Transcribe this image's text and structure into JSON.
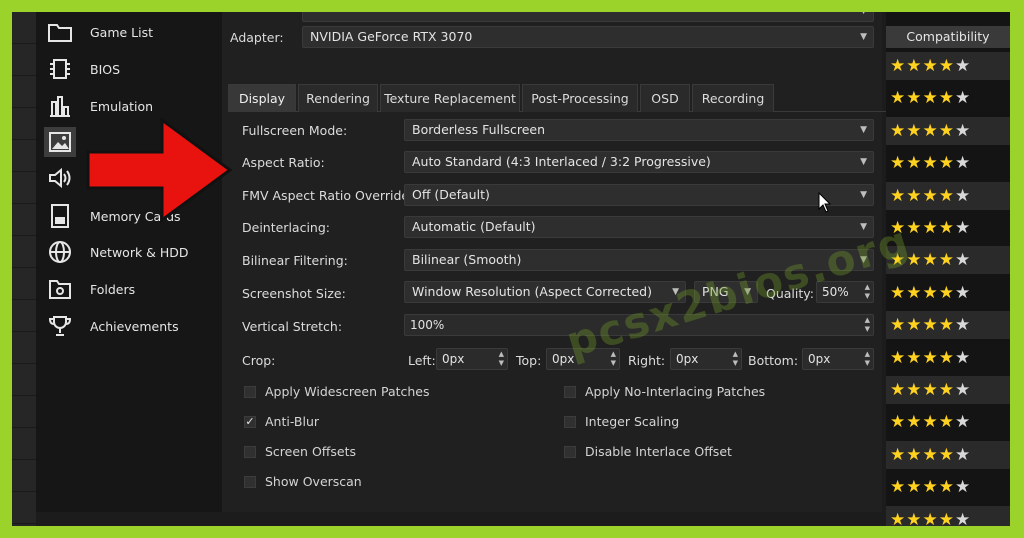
{
  "sidebar": {
    "items": [
      {
        "label": "Game List",
        "icon": "folder-icon"
      },
      {
        "label": "BIOS",
        "icon": "chip-icon"
      },
      {
        "label": "Emulation",
        "icon": "emulation-icon"
      },
      {
        "label": "",
        "icon": "image-icon",
        "selected": true
      },
      {
        "label": "",
        "icon": "speaker-icon"
      },
      {
        "label": "Memory Cards",
        "icon": "memory-card-icon"
      },
      {
        "label": "Network & HDD",
        "icon": "globe-icon"
      },
      {
        "label": "Folders",
        "icon": "folder-gear-icon"
      },
      {
        "label": "Achievements",
        "icon": "trophy-icon"
      }
    ]
  },
  "settings": {
    "adapter_label": "Adapter:",
    "adapter_value": "NVIDIA GeForce RTX 3070",
    "tabs": [
      {
        "label": "Display",
        "active": true
      },
      {
        "label": "Rendering"
      },
      {
        "label": "Texture Replacement"
      },
      {
        "label": "Post-Processing"
      },
      {
        "label": "OSD"
      },
      {
        "label": "Recording"
      }
    ],
    "rows": {
      "fullscreen_label": "Fullscreen Mode:",
      "fullscreen_value": "Borderless Fullscreen",
      "aspect_label": "Aspect Ratio:",
      "aspect_value": "Auto Standard (4:3 Interlaced / 3:2 Progressive)",
      "fmv_label": "FMV Aspect Ratio Override:",
      "fmv_value": "Off (Default)",
      "deinterlace_label": "Deinterlacing:",
      "deinterlace_value": "Automatic (Default)",
      "bilinear_label": "Bilinear Filtering:",
      "bilinear_value": "Bilinear (Smooth)",
      "screenshot_label": "Screenshot Size:",
      "screenshot_value": "Window Resolution (Aspect Corrected)",
      "format_value": "PNG",
      "quality_label": "Quality:",
      "quality_value": "50%",
      "stretch_label": "Vertical Stretch:",
      "stretch_value": "100%",
      "crop_label": "Crop:",
      "left_label": "Left:",
      "left_value": "0px",
      "top_label": "Top:",
      "top_value": "0px",
      "right_label": "Right:",
      "right_value": "0px",
      "bottom_label": "Bottom:",
      "bottom_value": "0px"
    },
    "checkboxes": {
      "widescreen": {
        "label": "Apply Widescreen Patches",
        "checked": false
      },
      "nointerlace": {
        "label": "Apply No-Interlacing Patches",
        "checked": false
      },
      "antiblur": {
        "label": "Anti-Blur",
        "checked": true
      },
      "integer": {
        "label": "Integer Scaling",
        "checked": false
      },
      "offsets": {
        "label": "Screen Offsets",
        "checked": false
      },
      "interlace_offset": {
        "label": "Disable Interlace Offset",
        "checked": false
      },
      "overscan": {
        "label": "Show Overscan",
        "checked": false
      }
    }
  },
  "compat": {
    "header": "Compatibility",
    "rows": [
      4,
      4,
      4,
      4,
      4,
      4,
      4,
      4,
      4,
      4,
      4,
      4,
      4,
      4,
      4
    ]
  },
  "watermark": "pcsx2bios.org",
  "colors": {
    "accent_green": "#9bd32a",
    "arrow_red": "#e8130f",
    "star": "#ffd21f"
  }
}
